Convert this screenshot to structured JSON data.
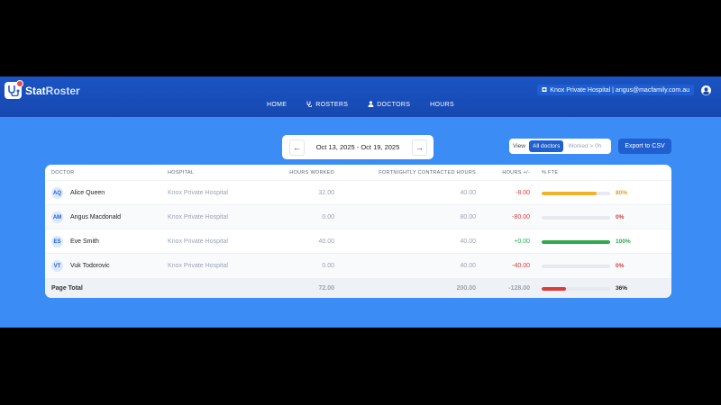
{
  "header": {
    "brand_part1": "Stat",
    "brand_part2": "Roster",
    "nav": [
      {
        "label": "HOME",
        "icon": ""
      },
      {
        "label": "ROSTERS",
        "icon": "stethoscope-icon"
      },
      {
        "label": "DOCTORS",
        "icon": "user-icon"
      },
      {
        "label": "HOURS",
        "icon": ""
      }
    ],
    "user_info": "Knox Private Hospital | angus@macfamily.com.au"
  },
  "week": {
    "range": "Oct 13, 2025 - Oct 19, 2025",
    "prev": "←",
    "next": "→"
  },
  "view": {
    "label": "View",
    "options": [
      "All doctors",
      "Worked > 0h"
    ],
    "selected": "All doctors"
  },
  "export_label": "Export to CSV",
  "table": {
    "columns": [
      "DOCTOR",
      "HOSPITAL",
      "HOURS WORKED",
      "FORTNIGHTLY CONTRACTED HOURS",
      "HOURS +/-",
      "% FTE"
    ],
    "rows": [
      {
        "initials": "AQ",
        "name": "Alice Queen",
        "hospital": "Knox Private Hospital",
        "worked": "32.00",
        "contracted": "40.00",
        "diff": "-8.00",
        "fte": "80%",
        "fte_value": 0.8
      },
      {
        "initials": "AM",
        "name": "Angus Macdonald",
        "hospital": "Knox Private Hospital",
        "worked": "0.00",
        "contracted": "80.00",
        "diff": "-80.00",
        "fte": "0%",
        "fte_value": 0.0
      },
      {
        "initials": "ES",
        "name": "Eve Smith",
        "hospital": "Knox Private Hospital",
        "worked": "40.00",
        "contracted": "40.00",
        "diff": "+0.00",
        "fte": "100%",
        "fte_value": 1.0
      },
      {
        "initials": "VT",
        "name": "Vuk Todorovic",
        "hospital": "Knox Private Hospital",
        "worked": "0.00",
        "contracted": "40.00",
        "diff": "-40.00",
        "fte": "0%",
        "fte_value": 0.0
      }
    ],
    "total": {
      "label": "Page Total",
      "worked": "72.00",
      "contracted": "200.00",
      "diff": "-128.00",
      "fte": "36%",
      "fte_value": 0.36
    }
  },
  "colors": {
    "accent": "#1f5fcf",
    "background": "#3b8cf5",
    "negative": "#dc3b3b",
    "positive": "#2fa84f",
    "partial": "#f0b429"
  }
}
